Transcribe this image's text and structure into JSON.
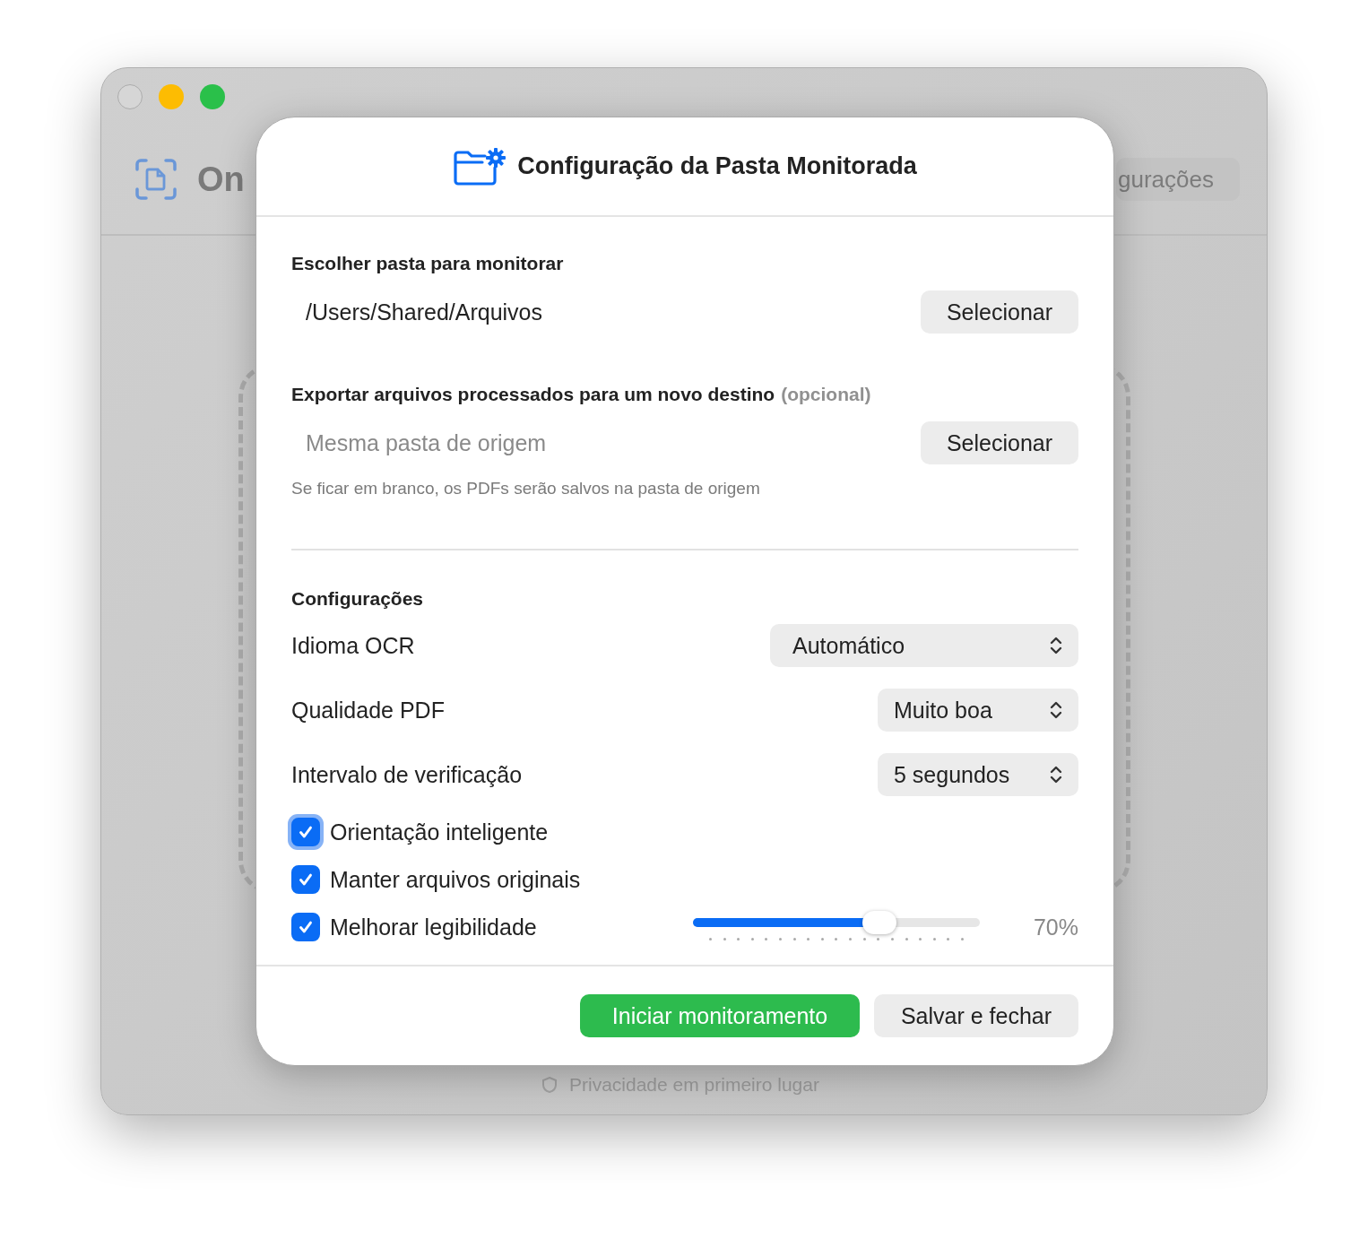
{
  "app": {
    "title": "On",
    "toolbar_button": "gurações",
    "footer_note": "Privacidade em primeiro lugar"
  },
  "dialog": {
    "title": "Configuração da Pasta Monitorada",
    "sections": [
      {
        "label": "Escolher pasta para monitorar",
        "field": {
          "value": "/Users/Shared/Arquivos"
        },
        "button": "Selecionar"
      },
      {
        "label": "Exportar arquivos processados para um novo destino",
        "label_suffix": "(opcional)",
        "field": {
          "placeholder": "Mesma pasta de origem"
        },
        "button": "Selecionar",
        "hint": "Se ficar em branco, os PDFs serão salvos na pasta de origem"
      }
    ],
    "settings_title": "Configurações",
    "settings": [
      {
        "kind": "select",
        "label": "Idioma OCR",
        "value": "Automático"
      },
      {
        "kind": "select",
        "label": "Qualidade PDF",
        "value": "Muito boa"
      },
      {
        "kind": "select",
        "label": "Intervalo de verificação",
        "value": "5 segundos"
      },
      {
        "kind": "checkbox",
        "label": "Orientação inteligente",
        "checked": true,
        "focused": true
      },
      {
        "kind": "checkbox",
        "label": "Manter arquivos originais",
        "checked": true,
        "focused": false
      },
      {
        "kind": "slider",
        "label": "Melhorar legibilidade",
        "checked": true,
        "focused": false,
        "level": 0.65,
        "reading": "70%"
      }
    ],
    "buttons": [
      {
        "kind": "primary",
        "label": "Iniciar monitoramento"
      },
      {
        "kind": "secondary",
        "label": "Salvar e fechar"
      }
    ]
  }
}
